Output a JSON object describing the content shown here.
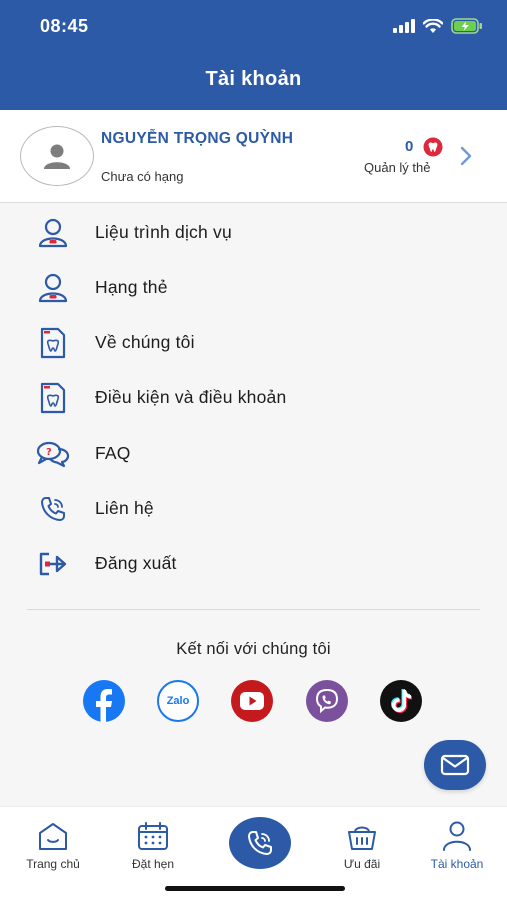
{
  "status_bar": {
    "time": "08:45"
  },
  "header": {
    "title": "Tài khoản"
  },
  "profile": {
    "name": "NGUYỄN TRỌNG QUỲNH",
    "rank": "Chưa có hạng",
    "card_count": "0",
    "card_label": "Quản lý thẻ"
  },
  "menu": {
    "items": [
      {
        "label": "Liệu trình dịch vụ",
        "icon": "user-treatment-icon"
      },
      {
        "label": "Hạng thẻ",
        "icon": "user-rank-icon"
      },
      {
        "label": "Về chúng tôi",
        "icon": "document-tooth-icon"
      },
      {
        "label": "Điều kiện và điều khoản",
        "icon": "document-tooth-icon"
      },
      {
        "label": "FAQ",
        "icon": "faq-chat-icon"
      },
      {
        "label": "Liên hệ",
        "icon": "phone-icon"
      },
      {
        "label": "Đăng xuất",
        "icon": "logout-icon"
      }
    ]
  },
  "connect": {
    "title": "Kết nối với chúng tôi",
    "zalo_text": "Zalo",
    "networks": [
      "facebook-icon",
      "zalo-icon",
      "youtube-icon",
      "viber-icon",
      "tiktok-icon"
    ]
  },
  "bottom_nav": {
    "items": [
      {
        "label": "Trang chủ",
        "icon": "home-icon"
      },
      {
        "label": "Đặt hẹn",
        "icon": "calendar-icon"
      },
      {
        "label": "Ưu đãi",
        "icon": "gift-basket-icon"
      },
      {
        "label": "Tài khoản",
        "icon": "account-icon",
        "active": true
      }
    ]
  },
  "colors": {
    "primary": "#2d5aa7",
    "accent_red": "#e0283c",
    "facebook": "#1877f2",
    "youtube": "#c4191d",
    "viber": "#7b519d",
    "tiktok": "#111111"
  }
}
